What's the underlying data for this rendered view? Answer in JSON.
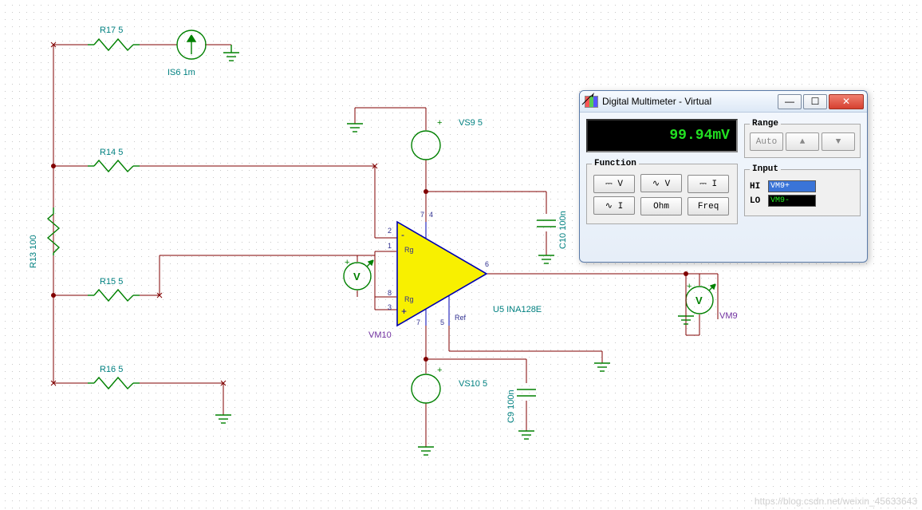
{
  "components": {
    "R17": {
      "name": "R17",
      "value": "5",
      "label": "R17 5"
    },
    "R14": {
      "name": "R14",
      "value": "5",
      "label": "R14 5"
    },
    "R15": {
      "name": "R15",
      "value": "5",
      "label": "R15 5"
    },
    "R16": {
      "name": "R16",
      "value": "5",
      "label": "R16 5"
    },
    "R13": {
      "name": "R13",
      "value": "100",
      "label": "R13 100"
    },
    "IS6": {
      "name": "IS6",
      "value": "1m",
      "label": "IS6 1m"
    },
    "VS9": {
      "name": "VS9",
      "value": "5",
      "label": "VS9 5"
    },
    "VS10": {
      "name": "VS10",
      "value": "5",
      "label": "VS10 5"
    },
    "C10": {
      "name": "C10",
      "value": "100n",
      "label": "C10 100n"
    },
    "C9": {
      "name": "C9",
      "value": "100n",
      "label": "C9 100n"
    },
    "U5": {
      "name": "U5",
      "part": "INA128E",
      "label": "U5 INA128E",
      "rg_top": "Rg",
      "rg_bot": "Rg",
      "ref": "Ref"
    },
    "VM10": {
      "label": "VM10",
      "letter": "V"
    },
    "VM9": {
      "label": "VM9",
      "letter": "V"
    }
  },
  "pins": {
    "p1": "1",
    "p2": "2",
    "p3": "3",
    "p4": "4",
    "p5": "5",
    "p6": "6",
    "p7": "7",
    "p8": "8"
  },
  "meter": {
    "title": "Digital Multimeter - Virtual",
    "display": "99.94mV",
    "range_legend": "Range",
    "range_auto": "Auto",
    "range_up": "▲",
    "range_down": "▼",
    "function_legend": "Function",
    "fn_dc_v": "⎓ V",
    "fn_ac_v": "∿ V",
    "fn_dc_i": "⎓ I",
    "fn_ac_i": "∿ I",
    "fn_ohm": "Ohm",
    "fn_freq": "Freq",
    "input_legend": "Input",
    "hi_label": "HI",
    "lo_label": "LO",
    "hi_value": "VM9+",
    "lo_value": "VM9-",
    "win_min": "—",
    "win_max": "☐",
    "win_close": "✕"
  },
  "plus": "+",
  "watermark": "https://blog.csdn.net/weixin_45633643"
}
